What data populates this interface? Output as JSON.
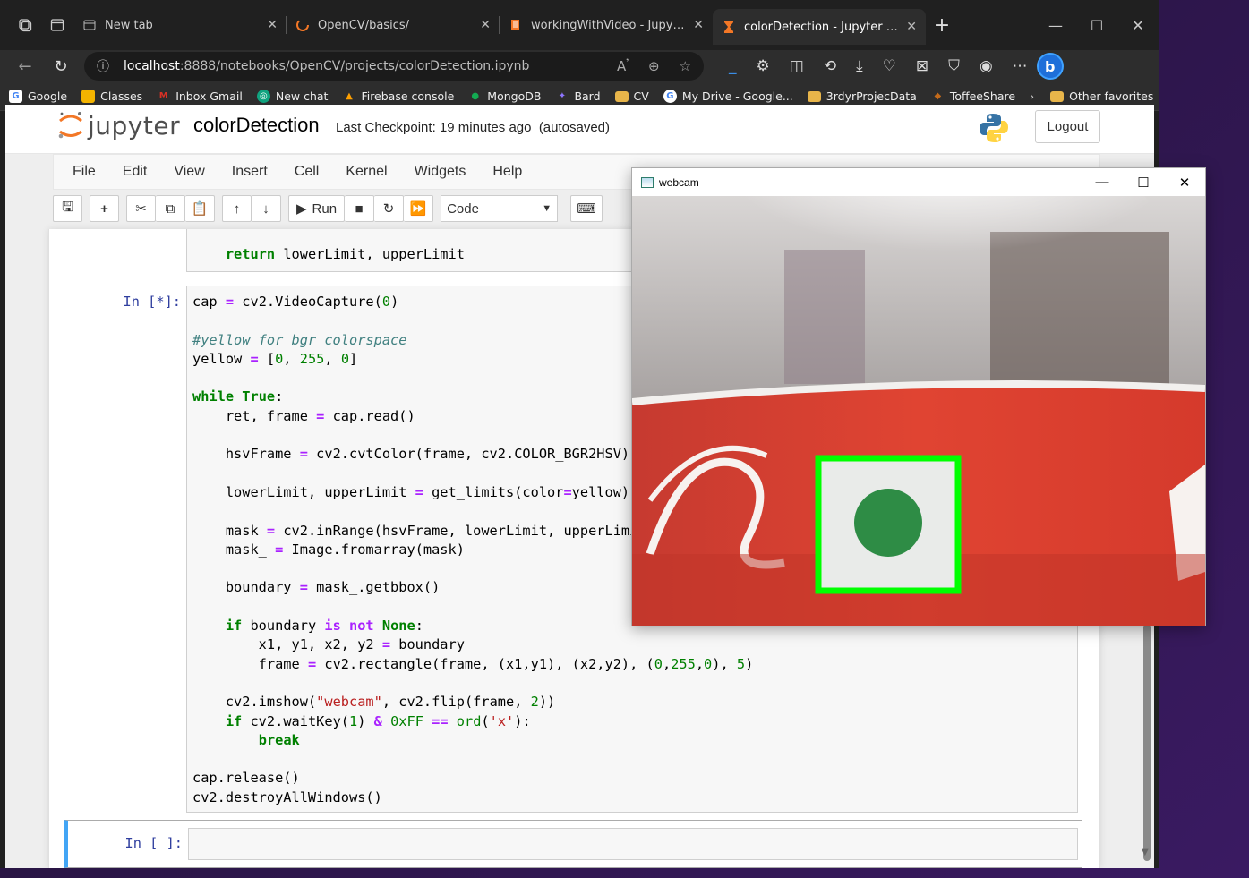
{
  "browser": {
    "tabs": [
      {
        "title": "New tab",
        "favicon": "newtab-icon"
      },
      {
        "title": "OpenCV/basics/",
        "favicon": "jupyter-spinner-icon"
      },
      {
        "title": "workingWithVideo - Jupyter Note",
        "favicon": "notebook-icon"
      },
      {
        "title": "colorDetection - Jupyter Notebo",
        "favicon": "hourglass-icon",
        "active": true
      }
    ],
    "address": {
      "host": "localhost",
      "path": ":8888/notebooks/OpenCV/projects/colorDetection.ipynb"
    },
    "bookmarks": [
      {
        "label": "Google",
        "color": "#ffffff",
        "glyph": "G"
      },
      {
        "label": "Classes",
        "color": "#f4b400",
        "glyph": "▪"
      },
      {
        "label": "Inbox Gmail",
        "color": "#d93025",
        "glyph": "M"
      },
      {
        "label": "New chat",
        "color": "#10a37f",
        "glyph": "◎"
      },
      {
        "label": "Firebase console",
        "color": "#ffa000",
        "glyph": "▲"
      },
      {
        "label": "MongoDB",
        "color": "#13aa52",
        "glyph": "●"
      },
      {
        "label": "Bard",
        "color": "#8e75ff",
        "glyph": "✦"
      },
      {
        "label": "CV",
        "color": "#e8b54a",
        "glyph": "▬"
      },
      {
        "label": "My Drive - Google...",
        "color": "#ffffff",
        "glyph": "G"
      },
      {
        "label": "3rdyrProjecData",
        "color": "#e8b54a",
        "glyph": "▬"
      },
      {
        "label": "ToffeeShare",
        "color": "#c46a1a",
        "glyph": "◆"
      }
    ],
    "other_favorites": "Other favorites"
  },
  "jupyter": {
    "logo_text": "jupyter",
    "notebook_name": "colorDetection",
    "checkpoint": "Last Checkpoint: 19 minutes ago",
    "autosave": "(autosaved)",
    "logout": "Logout",
    "menu": [
      "File",
      "Edit",
      "View",
      "Insert",
      "Cell",
      "Kernel",
      "Widgets",
      "Help"
    ],
    "run_label": "Run",
    "cell_type": "Code",
    "prompt_running": "In [*]:",
    "prompt_empty": "In [ ]:",
    "prev_cell_code": "    return lowerLimit, upperLimit"
  },
  "webcam": {
    "title": "webcam"
  }
}
